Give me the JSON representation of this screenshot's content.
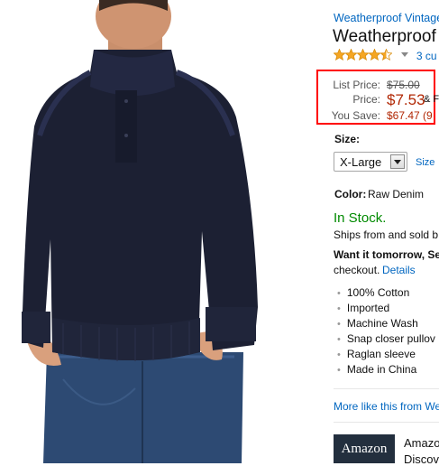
{
  "brand": {
    "link_text": "Weatherproof Vintage"
  },
  "product": {
    "title": "Weatherproof",
    "rating": 4.5,
    "review_count_text": "3 cu"
  },
  "pricing": {
    "list_price_label": "List Price:",
    "list_price": "$75.00",
    "price_label": "Price:",
    "price": "$7.53",
    "price_suffix": "& F",
    "you_save_label": "You Save:",
    "you_save": "$67.47 (9"
  },
  "size": {
    "label": "Size:",
    "selected": "X-Large",
    "chart_link": "Size"
  },
  "color": {
    "label": "Color:",
    "value": "Raw Denim"
  },
  "availability": {
    "stock": "In Stock.",
    "ships_from": "Ships from and sold b",
    "delivery": "Want it tomorrow, Se",
    "checkout": "checkout.",
    "details_link": "Details"
  },
  "features": [
    "100% Cotton",
    "Imported",
    "Machine Wash",
    "Snap closer pullov",
    "Raglan sleeve",
    "Made in China"
  ],
  "more_like_this": "More like this from We",
  "ad": {
    "logo_text": "Amazon",
    "title": "Amazo",
    "subtitle": "Discov"
  },
  "colors": {
    "link": "#0066c0",
    "price": "#b12704",
    "in_stock": "#008a00",
    "highlight_border": "#ff0000",
    "sweater": "#1c2033",
    "jeans": "#2d4a73"
  }
}
